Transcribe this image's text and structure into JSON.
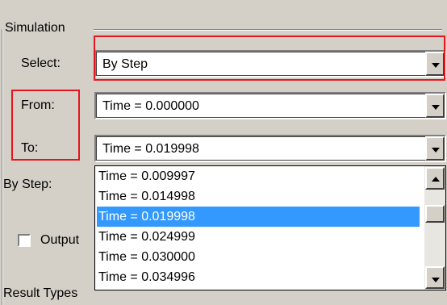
{
  "simulation": {
    "group_label": "Simulation",
    "select_label": "Select:",
    "select_value": "By Step",
    "from_label": "From:",
    "from_value": "Time = 0.000000",
    "to_label": "To:",
    "to_value": "Time = 0.019998",
    "by_step_label": "By Step:",
    "output_label": "Output",
    "result_types_label": "Result Types",
    "dropdown_items": [
      "Time = 0.009997",
      "Time = 0.014998",
      "Time = 0.019998",
      "Time = 0.024999",
      "Time = 0.030000",
      "Time = 0.034996"
    ],
    "selected_item": "Time = 0.019998"
  },
  "colors": {
    "highlight_box": "#e8141e",
    "selection": "#3399ff",
    "panel": "#d4d0c8"
  }
}
